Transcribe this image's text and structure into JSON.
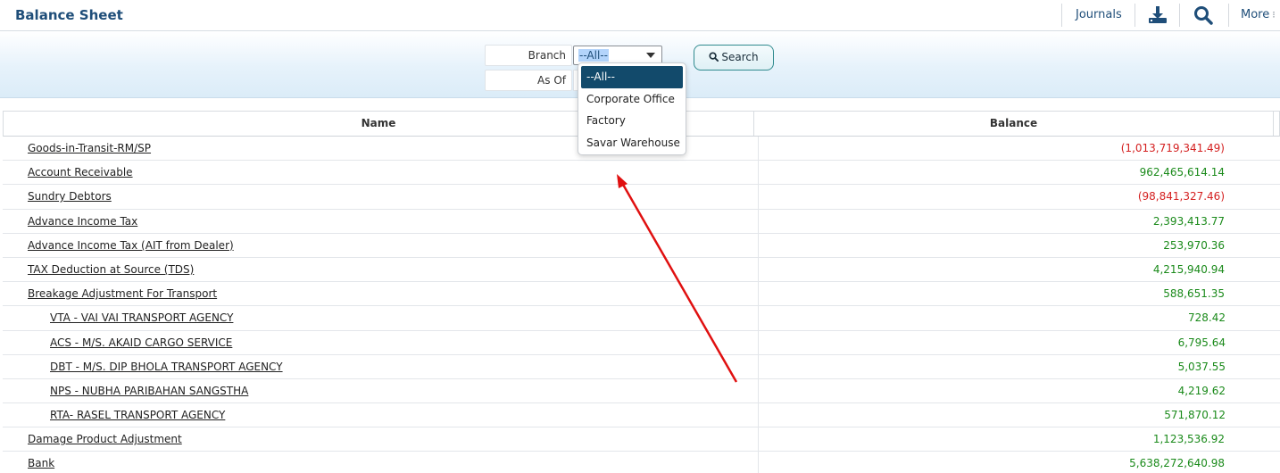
{
  "header": {
    "title": "Balance Sheet",
    "journals_label": "Journals",
    "more_label": "More",
    "download_icon": "download-icon",
    "search_icon": "magnifier-icon"
  },
  "filters": {
    "branch_label": "Branch",
    "branch_value": "--All--",
    "asof_label": "As Of",
    "search_button_label": "Search",
    "branch_options": [
      "--All--",
      "Corporate Office",
      "Factory",
      "Savar Warehouse"
    ]
  },
  "table": {
    "columns": [
      "Name",
      "Balance"
    ],
    "rows": [
      {
        "name": "Goods-in-Transit-RM/SP",
        "balance": "(1,013,719,341.49)"
      },
      {
        "name": "Account Receivable",
        "balance": "962,465,614.14"
      },
      {
        "name": "Sundry Debtors",
        "balance": "(98,841,327.46)"
      },
      {
        "name": "Advance Income Tax",
        "balance": "2,393,413.77"
      },
      {
        "name": "Advance Income Tax (AIT from Dealer)",
        "balance": "253,970.36"
      },
      {
        "name": "TAX Deduction at Source (TDS)",
        "balance": "4,215,940.94"
      },
      {
        "name": "Breakage Adjustment For Transport",
        "balance": "588,651.35"
      },
      {
        "name": "VTA - VAI VAI TRANSPORT AGENCY",
        "balance": "728.42"
      },
      {
        "name": "ACS - M/S. AKAID CARGO SERVICE",
        "balance": "6,795.64"
      },
      {
        "name": "DBT - M/S. DIP BHOLA TRANSPORT AGENCY",
        "balance": "5,037.55"
      },
      {
        "name": "NPS - NUBHA PARIBAHAN SANGSTHA",
        "balance": "4,219.62"
      },
      {
        "name": "RTA- RASEL TRANSPORT AGENCY",
        "balance": "571,870.12"
      },
      {
        "name": "Damage Product Adjustment",
        "balance": "1,123,536.92"
      },
      {
        "name": "Bank",
        "balance": "5,638,272,640.98"
      }
    ]
  },
  "colors": {
    "title": "#1f4e79",
    "positive": "#1a8a1a",
    "negative": "#d42020",
    "dropdown_active": "#124a6b",
    "annotation_arrow": "#e01010"
  }
}
